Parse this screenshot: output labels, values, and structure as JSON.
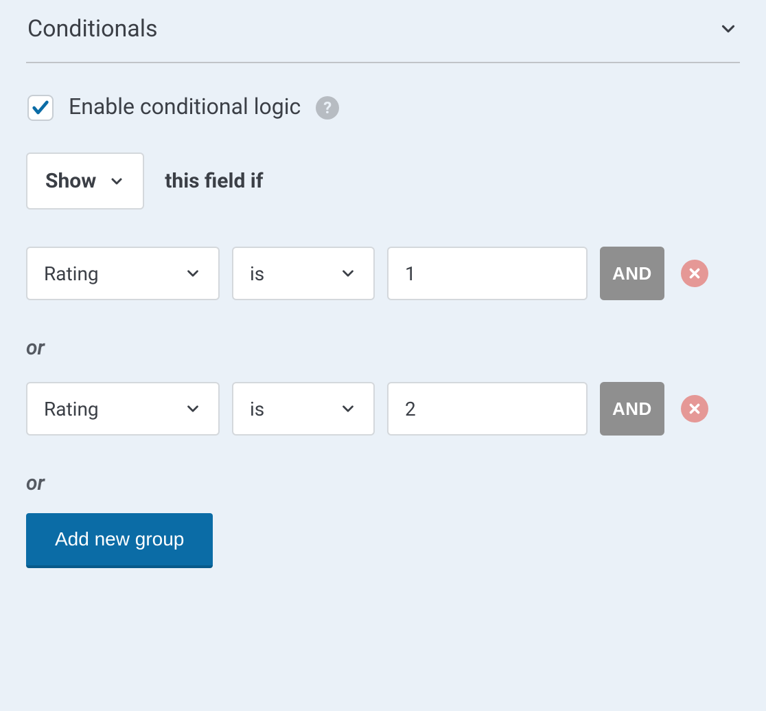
{
  "header": {
    "title": "Conditionals"
  },
  "enable": {
    "checked": true,
    "label": "Enable conditional logic",
    "help_symbol": "?"
  },
  "action": {
    "selected": "Show",
    "suffix": "this field if"
  },
  "conditions": [
    {
      "field": "Rating",
      "operator": "is",
      "value": "1",
      "and_label": "AND"
    },
    {
      "field": "Rating",
      "operator": "is",
      "value": "2",
      "and_label": "AND"
    }
  ],
  "or_label": "or",
  "add_group_label": "Add new group"
}
